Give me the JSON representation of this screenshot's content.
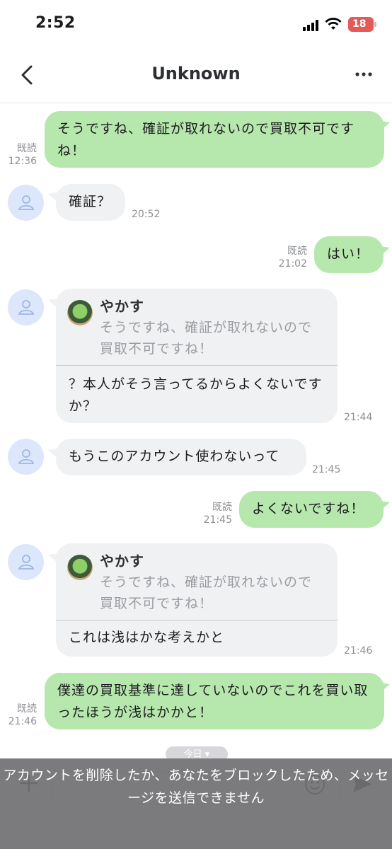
{
  "status_bar": {
    "time": "2:52",
    "battery": "18"
  },
  "header": {
    "title": "Unknown"
  },
  "messages": [
    {
      "side": "sent",
      "text": "そうですね、確証が取れないので買取不可ですね！",
      "read": "既読",
      "time": "12:36"
    },
    {
      "side": "received",
      "text": "確証？",
      "time": "20:52"
    },
    {
      "side": "sent",
      "text": "はい！",
      "read": "既読",
      "time": "21:02"
    },
    {
      "side": "received",
      "quote_name": "やかす",
      "quote_text": "そうですね、確証が取れないので買取不可ですね！",
      "text": "？本人がそう言ってるからよくないですか？",
      "time": "21:44"
    },
    {
      "side": "received",
      "text": "もうこのアカウント使わないって",
      "time": "21:45"
    },
    {
      "side": "sent",
      "text": "よくないですね！",
      "read": "既読",
      "time": "21:45"
    },
    {
      "side": "received",
      "quote_name": "やかす",
      "quote_text": "そうですね、確証が取れないので買取不可ですね！",
      "text": "これは浅はかな考えかと",
      "time": "21:46"
    },
    {
      "side": "sent",
      "text": "僕達の買取基準に達していないのでこれを買い取ったほうが浅はかかと！",
      "read": "既読",
      "time": "21:46"
    }
  ],
  "date_divider": "今日 ▾",
  "blocked_notice": "アカウントを削除したか、あなたをブロックしたため、メッセージを送信できません",
  "colors": {
    "sent_bubble": "#b6e7ad",
    "received_bubble": "#f0f1f3",
    "overlay": "#707072"
  }
}
